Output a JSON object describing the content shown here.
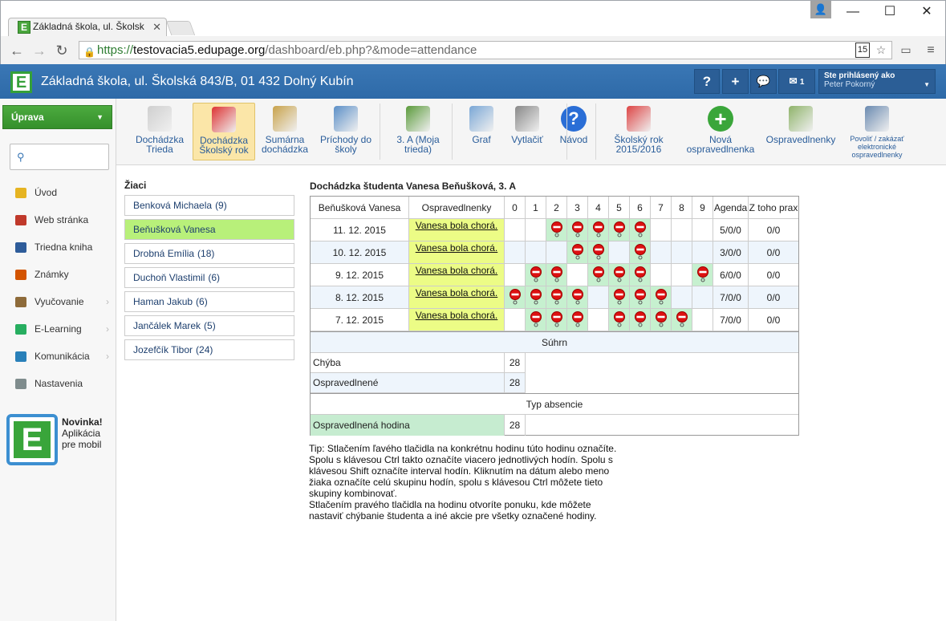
{
  "browser": {
    "tab_title": "Základná škola, ul. Školsk",
    "tab_favicon": "E",
    "url_scheme": "https://",
    "url_host": "testovacia5.edupage.org",
    "url_path": "/dashboard/eb.php?&mode=attendance",
    "ext_badge": "15",
    "user_icon": "person-icon"
  },
  "header": {
    "logo": "E",
    "school_name": "Základná škola, ul. Školská 843/B, 01 432 Dolný Kubín",
    "help_label": "?",
    "add_label": "+",
    "msg_count": "1",
    "login_label": "Ste prihlásený ako",
    "login_user": "Peter Pokorný"
  },
  "sidebar": {
    "action_button": "Úprava",
    "menu": [
      {
        "label": "Úvod",
        "color": "#e6b422"
      },
      {
        "label": "Web stránka",
        "color": "#c0392b"
      },
      {
        "label": "Triedna kniha",
        "color": "#2e5c9a"
      },
      {
        "label": "Známky",
        "color": "#d35400"
      },
      {
        "label": "Vyučovanie",
        "color": "#8e6b3a"
      },
      {
        "label": "E-Learning",
        "color": "#27ae60"
      },
      {
        "label": "Komunikácia",
        "color": "#2980b9"
      },
      {
        "label": "Nastavenia",
        "color": "#7f8c8d"
      }
    ],
    "promo_title": "Novinka!",
    "promo_line1": "Aplikácia",
    "promo_line2": "pre mobil"
  },
  "ribbon": {
    "buttons": [
      {
        "line1": "Dochádzka",
        "line2": "Trieda"
      },
      {
        "line1": "Dochádzka",
        "line2": "Školský rok"
      },
      {
        "line1": "Sumárna",
        "line2": "dochádzka"
      },
      {
        "line1": "Príchody do",
        "line2": "školy"
      },
      {
        "line1": "3. A (Moja",
        "line2": "trieda)"
      },
      {
        "line1": "Graf",
        "line2": ""
      },
      {
        "line1": "Vytlačiť",
        "line2": ""
      },
      {
        "line1": "Návod",
        "line2": ""
      },
      {
        "line1": "Školský rok",
        "line2": "2015/2016"
      },
      {
        "line1": "Nová",
        "line2": "ospravedlnenka"
      },
      {
        "line1": "Ospravedlnenky",
        "line2": ""
      },
      {
        "line1": "Povoliť / zakázať",
        "line2": "elektronické",
        "line3": "ospravedlnenky"
      }
    ]
  },
  "students": {
    "title": "Žiaci",
    "items": [
      {
        "name": "Benková Michaela",
        "count": "(9)"
      },
      {
        "name": "Beňušková Vanesa",
        "count": ""
      },
      {
        "name": "Drobná Emília",
        "count": "(18)"
      },
      {
        "name": "Duchoň Vlastimil",
        "count": "(6)"
      },
      {
        "name": "Haman Jakub",
        "count": "(6)"
      },
      {
        "name": "Jančálek Marek",
        "count": "(5)"
      },
      {
        "name": "Jozefčík Tibor",
        "count": "(24)"
      }
    ]
  },
  "attendance": {
    "title": "Dochádzka študenta Vanesa Beňušková, 3. A",
    "header_name": "Beňušková Vanesa",
    "header_excuse": "Ospravedlnenky",
    "lessons": [
      "0",
      "1",
      "2",
      "3",
      "4",
      "5",
      "6",
      "7",
      "8",
      "9"
    ],
    "header_agenda": "Agenda",
    "header_practice": "Z toho prax",
    "rows": [
      {
        "date": "11. 12. 2015",
        "excuse": "Vanesa bola chorá.",
        "absent": [
          2,
          3,
          4,
          5,
          6
        ],
        "agenda": "5/0/0",
        "practice": "0/0"
      },
      {
        "date": "10. 12. 2015",
        "excuse": "Vanesa bola chorá.",
        "absent": [
          3,
          4,
          6
        ],
        "agenda": "3/0/0",
        "practice": "0/0"
      },
      {
        "date": "9. 12. 2015",
        "excuse": "Vanesa bola chorá.",
        "absent": [
          1,
          2,
          4,
          5,
          6,
          9
        ],
        "agenda": "6/0/0",
        "practice": "0/0"
      },
      {
        "date": "8. 12. 2015",
        "excuse": "Vanesa bola chorá.",
        "absent": [
          0,
          1,
          2,
          3,
          5,
          6,
          7
        ],
        "agenda": "7/0/0",
        "practice": "0/0"
      },
      {
        "date": "7. 12. 2015",
        "excuse": "Vanesa bola chorá.",
        "absent": [
          1,
          2,
          3,
          5,
          6,
          7,
          8
        ],
        "agenda": "7/0/0",
        "practice": "0/0"
      }
    ],
    "summary_title": "Súhrn",
    "summary": [
      {
        "label": "Chýba",
        "value": "28"
      },
      {
        "label": "Ospravedlnené",
        "value": "28"
      }
    ],
    "type_title": "Typ absencie",
    "type_rows": [
      {
        "label": "Ospravedlnená hodina",
        "value": "28"
      }
    ]
  },
  "tip": {
    "line1": "Tip: Stlačením ľavého tlačidla na konkrétnu hodinu túto hodinu označíte.",
    "line2": "Spolu s klávesou Ctrl takto označíte viacero jednotlivých hodín. Spolu s",
    "line3": "klávesou Shift označíte interval hodín. Kliknutím na dátum alebo meno",
    "line4": "žiaka označíte celú skupinu hodín, spolu s klávesou Ctrl môžete tieto",
    "line5": "skupiny kombinovať.",
    "line6": "Stlačením pravého tlačidla na hodinu otvoríte ponuku, kde môžete",
    "line7": "nastaviť chýbanie študenta a iné akcie pre všetky označené hodiny."
  }
}
